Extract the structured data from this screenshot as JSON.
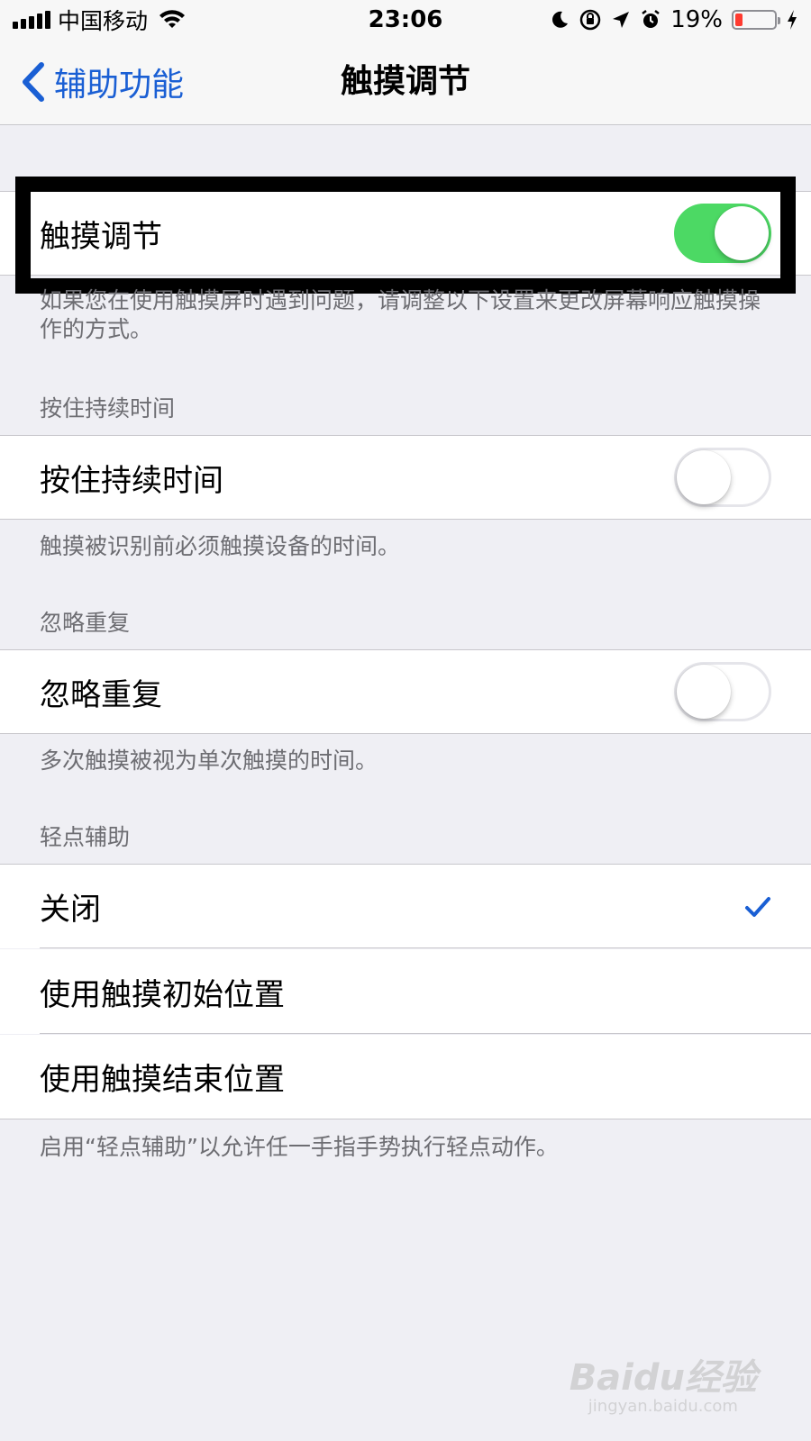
{
  "status_bar": {
    "carrier": "中国移动",
    "time": "23:06",
    "battery_percent": "19%",
    "icons": [
      "signal-icon",
      "wifi-icon",
      "moon-icon",
      "orientation-lock-icon",
      "location-icon",
      "alarm-icon",
      "battery-icon",
      "charging-icon"
    ]
  },
  "nav": {
    "back_label": "辅助功能",
    "title": "触摸调节"
  },
  "touch_accommodations": {
    "label": "触摸调节",
    "enabled": true,
    "footer": "如果您在使用触摸屏时遇到问题，请调整以下设置来更改屏幕响应触摸操作的方式。"
  },
  "hold_duration": {
    "header": "按住持续时间",
    "label": "按住持续时间",
    "enabled": false,
    "footer": "触摸被识别前必须触摸设备的时间。"
  },
  "ignore_repeat": {
    "header": "忽略重复",
    "label": "忽略重复",
    "enabled": false,
    "footer": "多次触摸被视为单次触摸的时间。"
  },
  "tap_assistance": {
    "header": "轻点辅助",
    "options": [
      {
        "label": "关闭",
        "selected": true
      },
      {
        "label": "使用触摸初始位置",
        "selected": false
      },
      {
        "label": "使用触摸结束位置",
        "selected": false
      }
    ],
    "footer": "启用“轻点辅助”以允许任一手指手势执行轻点动作。"
  },
  "watermark": {
    "main": "Baidu经验",
    "sub": "jingyan.baidu.com"
  },
  "colors": {
    "accent": "#1a5fd4",
    "toggle_on": "#4cd964",
    "background": "#efeff4",
    "battery_low": "#ff3b30"
  }
}
